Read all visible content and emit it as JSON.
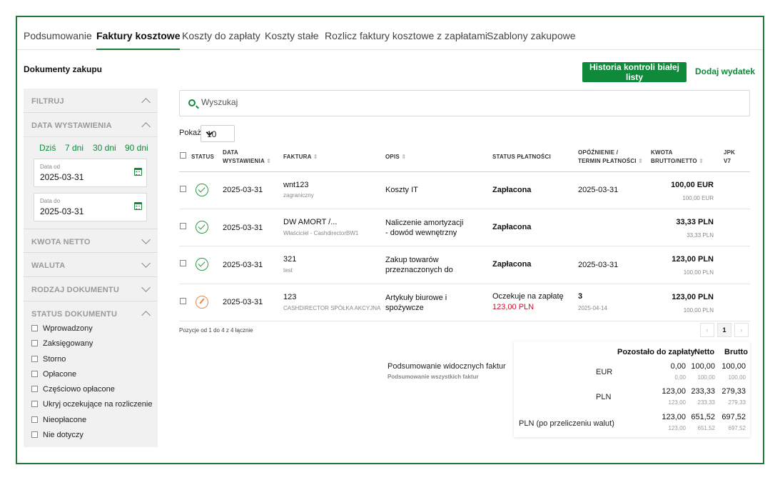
{
  "tabs": [
    {
      "label": "Podsumowanie",
      "active": false
    },
    {
      "label": "Faktury kosztowe",
      "active": true
    },
    {
      "label": "Koszty do zapłaty",
      "active": false
    },
    {
      "label": "Koszty stałe",
      "active": false
    },
    {
      "label": "Rozlicz faktury kosztowe z zapłatami",
      "active": false
    },
    {
      "label": "Szablony zakupowe",
      "active": false
    }
  ],
  "page_title": "Dokumenty zakupu",
  "actions": {
    "history_button": "Historia kontroli białej listy",
    "add_expense": "Dodaj wydatek"
  },
  "sidebar": {
    "filters_label": "FILTRUJ",
    "issue_date_label": "DATA WYSTAWIENIA",
    "quick": [
      "Dziś",
      "7 dni",
      "30 dni",
      "90 dni"
    ],
    "date_from": {
      "label": "Data od",
      "value": "2025-03-31"
    },
    "date_to": {
      "label": "Data do",
      "value": "2025-03-31"
    },
    "net_amount_label": "KWOTA NETTO",
    "currency_label": "WALUTA",
    "doc_type_label": "RODZAJ DOKUMENTU",
    "doc_status_label": "STATUS DOKUMENTU",
    "statuses": [
      "Wprowadzony",
      "Zaksięgowany",
      "Storno",
      "Opłacone",
      "Częściowo opłacone",
      "Ukryj oczekujące na rozliczenie",
      "Nieopłacone",
      "Nie dotyczy"
    ]
  },
  "search": {
    "placeholder": "Wyszukaj"
  },
  "page_size": {
    "label": "Pokaż",
    "value": "10"
  },
  "table": {
    "headers": {
      "status": "STATUS",
      "date_1": "DATA",
      "date_2": "WYSTAWIENIA",
      "invoice": "FAKTURA",
      "desc": "OPIS",
      "pay_status": "STATUS PŁATNOŚCI",
      "delay_1": "OPÓŹNIENIE /",
      "delay_2": "TERMIN PŁATNOŚCI",
      "amount_1": "KWOTA",
      "amount_2": "BRUTTO/NETTO",
      "jpk_1": "JPK",
      "jpk_2": "V7"
    },
    "rows": [
      {
        "date": "2025-03-31",
        "invoice": "wnt123",
        "invoice_sub": "zagraniczny",
        "desc_1": "Koszty IT",
        "desc_2": "",
        "pay_status": "Zapłacona",
        "pay_sub": "",
        "delay": "2025-03-31",
        "delay_sub": "",
        "gross": "100,00 EUR",
        "net": "100,00 EUR"
      },
      {
        "date": "2025-03-31",
        "invoice": "DW AMORT /...",
        "invoice_sub": "Właściciel - CashdirectorBW1",
        "desc_1": "Naliczenie amortyzacji",
        "desc_2": "- dowód wewnętrzny",
        "pay_status": "Zapłacona",
        "pay_sub": "",
        "delay": "",
        "delay_sub": "",
        "gross": "33,33 PLN",
        "net": "33,33 PLN"
      },
      {
        "date": "2025-03-31",
        "invoice": "321",
        "invoice_sub": "test",
        "desc_1": "Zakup towarów",
        "desc_2": "przeznaczonych do",
        "pay_status": "Zapłacona",
        "pay_sub": "",
        "delay": "2025-03-31",
        "delay_sub": "",
        "gross": "123,00 PLN",
        "net": "100,00 PLN"
      },
      {
        "date": "2025-03-31",
        "invoice": "123",
        "invoice_sub": "CASHDIRECTOR SPÓŁKA AKCYJNA",
        "desc_1": "Artykuły biurowe i",
        "desc_2": "spożywcze",
        "pay_status": "Oczekuje na zapłatę",
        "pay_sub": "123,00 PLN",
        "delay": "3",
        "delay_sub": "2025-04-14",
        "gross": "123,00 PLN",
        "net": "100,00 PLN"
      }
    ]
  },
  "positions_info": "Pozycje od 1 do 4 z 4 łącznie",
  "pager": {
    "prev": "‹",
    "current": "1",
    "next": "›"
  },
  "summary": {
    "visible_label": "Podsumowanie widocznych faktur",
    "all_label": "Podsumowanie wszystkich faktur",
    "headers": {
      "remaining": "Pozostało do zapłaty",
      "net": "Netto",
      "gross": "Brutto"
    },
    "rows": [
      {
        "label": "EUR",
        "remaining": "0,00",
        "remaining_sub": "0,00",
        "net": "100,00",
        "net_sub": "100,00",
        "gross": "100,00",
        "gross_sub": "100,00"
      },
      {
        "label": "PLN",
        "remaining": "123,00",
        "remaining_sub": "123,00",
        "net": "233,33",
        "net_sub": "233,33",
        "gross": "279,33",
        "gross_sub": "279,33"
      },
      {
        "label": "PLN (po przeliczeniu walut)",
        "remaining": "123,00",
        "remaining_sub": "123,00",
        "net": "651,52",
        "net_sub": "651,52",
        "gross": "697,52",
        "gross_sub": "697,52"
      }
    ]
  },
  "colors": {
    "accent": "#0e8a3a",
    "frame": "#1e7a36",
    "danger": "#c8102e",
    "pending": "#e38b4a"
  }
}
